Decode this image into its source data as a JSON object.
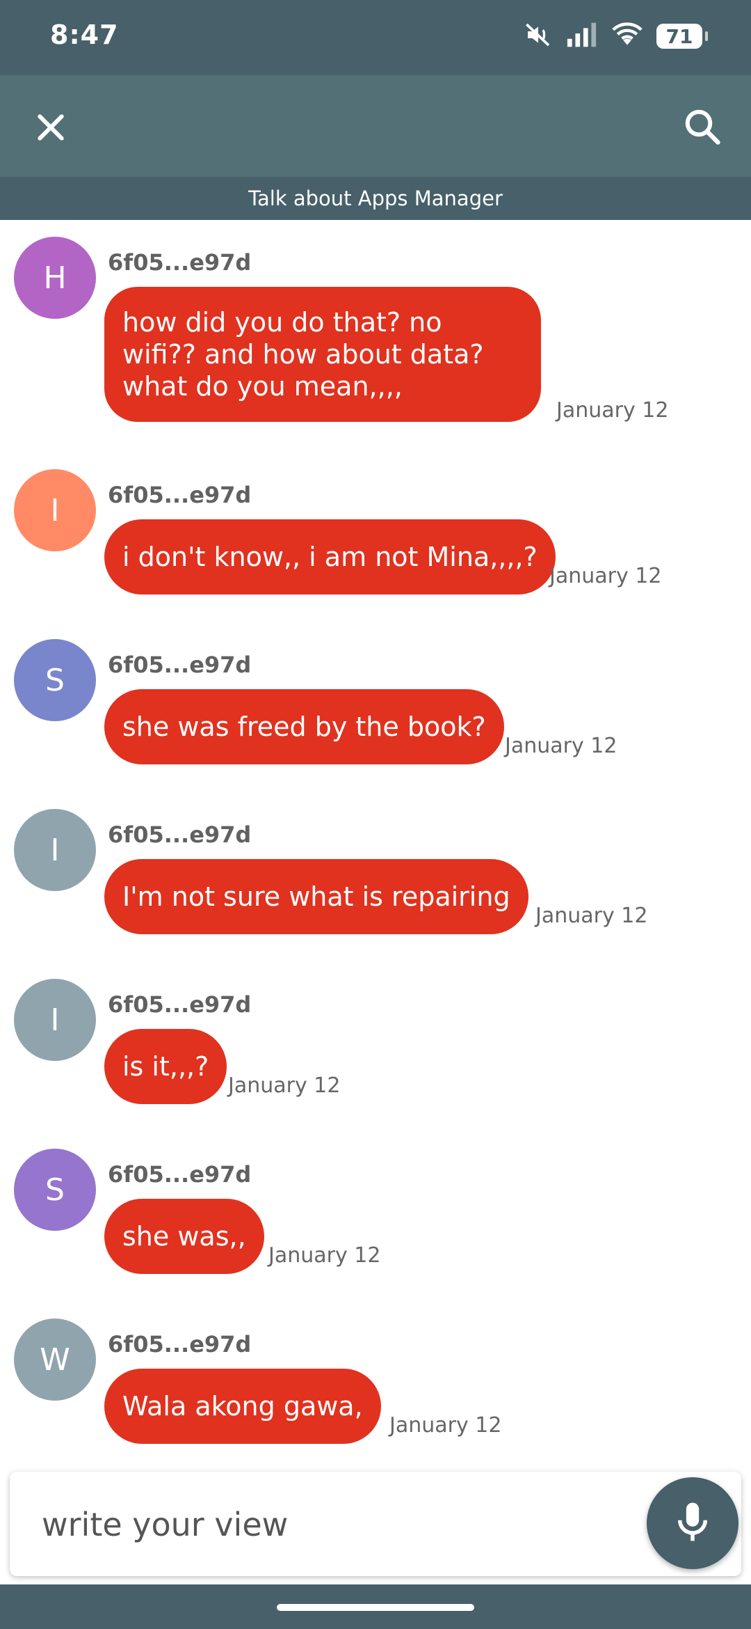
{
  "status_bar": {
    "time": "8:47",
    "battery": "71",
    "icons": [
      "mute-icon",
      "signal-icon",
      "wifi-icon",
      "battery-icon"
    ]
  },
  "toolbar": {
    "close_icon": "close-icon",
    "search_icon": "search-icon"
  },
  "topic": {
    "title": "Talk about Apps Manager"
  },
  "messages": [
    {
      "avatar_letter": "H",
      "avatar_color": "#b365c6",
      "sender": "6f05...e97d",
      "text": "how did you do that? no wifi?? and how about data? what do you mean,,,,",
      "time": "January 12"
    },
    {
      "avatar_letter": "I",
      "avatar_color": "#ff8a65",
      "sender": "6f05...e97d",
      "text": "i don't know,, i am not Mina,,,,?",
      "time": "January 12"
    },
    {
      "avatar_letter": "S",
      "avatar_color": "#7986cb",
      "sender": "6f05...e97d",
      "text": "she was freed by the book?",
      "time": "January 12"
    },
    {
      "avatar_letter": "I",
      "avatar_color": "#90a4ae",
      "sender": "6f05...e97d",
      "text": "I'm not sure what is repairing",
      "time": "January 12"
    },
    {
      "avatar_letter": "I",
      "avatar_color": "#90a4ae",
      "sender": "6f05...e97d",
      "text": "is it,,,?",
      "time": "January 12"
    },
    {
      "avatar_letter": "S",
      "avatar_color": "#9575cd",
      "sender": "6f05...e97d",
      "text": "she was,,",
      "time": "January 12"
    },
    {
      "avatar_letter": "W",
      "avatar_color": "#90a4ae",
      "sender": "6f05...e97d",
      "text": "Wala akong gawa,",
      "time": "January 12"
    }
  ],
  "composer": {
    "placeholder": "write your view",
    "mic_icon": "microphone-icon"
  },
  "colors": {
    "bubble": "#e0321f",
    "header": "#47606a",
    "toolbar": "#527076"
  }
}
